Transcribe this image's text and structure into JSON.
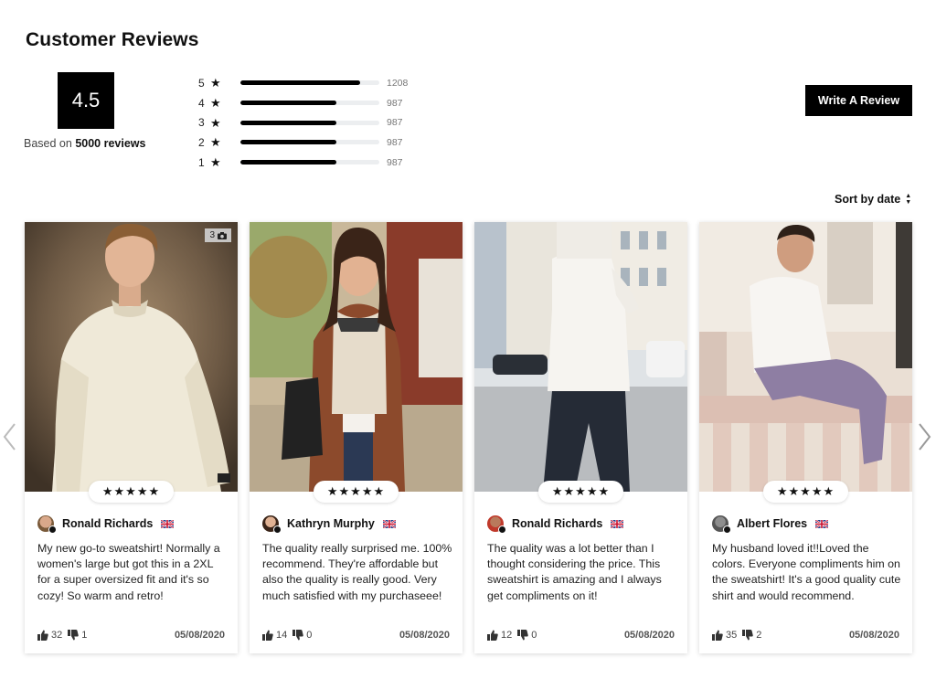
{
  "header": {
    "title": "Customer Reviews"
  },
  "summary": {
    "score": "4.5",
    "based_prefix": "Based on",
    "based_count": "5000 reviews"
  },
  "distribution": [
    {
      "stars": "5",
      "count": "1208",
      "fill": 0.86
    },
    {
      "stars": "4",
      "count": "987",
      "fill": 0.69
    },
    {
      "stars": "3",
      "count": "987",
      "fill": 0.69
    },
    {
      "stars": "2",
      "count": "987",
      "fill": 0.69
    },
    {
      "stars": "1",
      "count": "987",
      "fill": 0.69
    }
  ],
  "actions": {
    "write_review": "Write A Review",
    "sort_label": "Sort by date"
  },
  "icons": {
    "star": "star-icon",
    "thumbs_up": "thumbs-up-icon",
    "thumbs_down": "thumbs-down-icon",
    "camera": "camera-icon",
    "prev": "chevron-left-icon",
    "next": "chevron-right-icon"
  },
  "reviews": [
    {
      "name": "Ronald Richards",
      "text": "My new go-to sweatshirt! Normally a women's large but got this in a 2XL for a super oversized fit and it's so cozy! So warm and retro!",
      "up": "32",
      "down": "1",
      "date": "05/08/2020",
      "stars": "★★★★★",
      "photo_count": "3"
    },
    {
      "name": "Kathryn Murphy",
      "text": "The quality really surprised me. 100% recommend. They're affordable but also the quality is really good. Very much satisfied with my purchaseee!",
      "up": "14",
      "down": "0",
      "date": "05/08/2020",
      "stars": "★★★★★"
    },
    {
      "name": "Ronald Richards",
      "text": "The quality was a lot better than I thought considering the price. This sweatshirt is amazing and I always get compliments on it!",
      "up": "12",
      "down": "0",
      "date": "05/08/2020",
      "stars": "★★★★★"
    },
    {
      "name": "Albert Flores",
      "text": "My husband loved it!!Loved the colors. Everyone compliments him on the sweatshirt! It's a good quality cute shirt and would recommend.",
      "up": "35",
      "down": "2",
      "date": "05/08/2020",
      "stars": "★★★★★"
    }
  ],
  "colors": {
    "accent": "#000000",
    "bar_track": "#eceef0"
  }
}
